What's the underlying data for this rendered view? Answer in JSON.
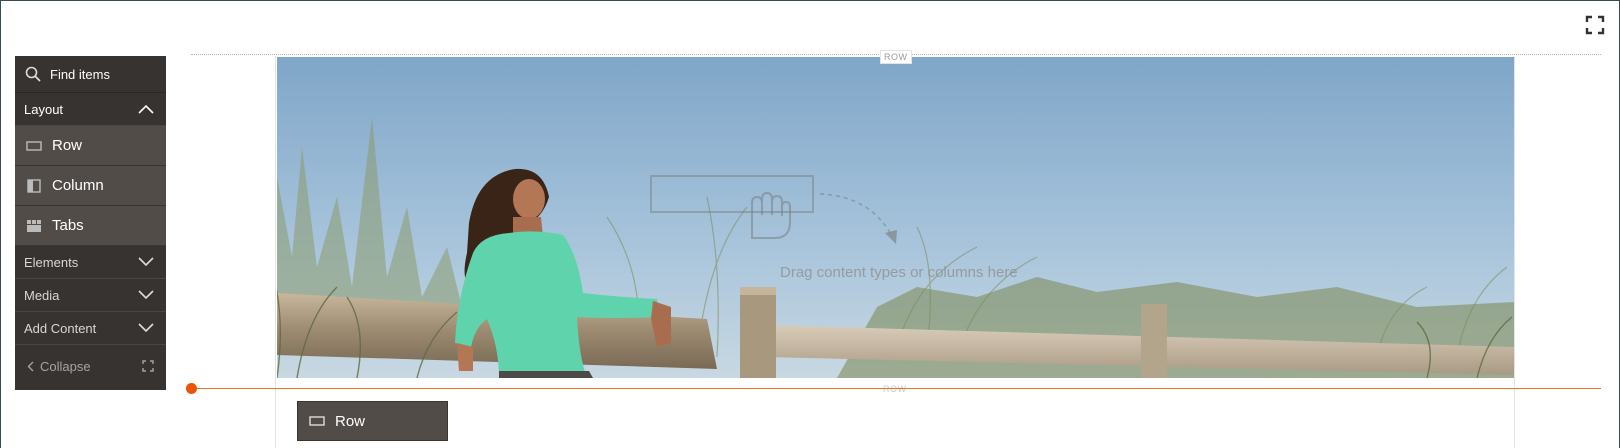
{
  "panel": {
    "search_label": "Find items",
    "groups": {
      "layout": "Layout",
      "elements": "Elements",
      "media": "Media",
      "add_content": "Add Content"
    },
    "layout_items": [
      {
        "label": "Row",
        "icon": "row-icon"
      },
      {
        "label": "Column",
        "icon": "column-icon"
      },
      {
        "label": "Tabs",
        "icon": "tabs-icon"
      }
    ],
    "collapse_label": "Collapse"
  },
  "stage": {
    "row_label_top": "ROW",
    "row_label_bottom": "ROW",
    "drop_hint": "Drag content types or columns here"
  },
  "drag_ghost": {
    "label": "Row",
    "icon": "row-icon"
  },
  "colors": {
    "panel_bg": "#373330",
    "panel_item_bg": "#524c48",
    "insert_line": "#e5772b",
    "insert_dot": "#eb5202"
  }
}
